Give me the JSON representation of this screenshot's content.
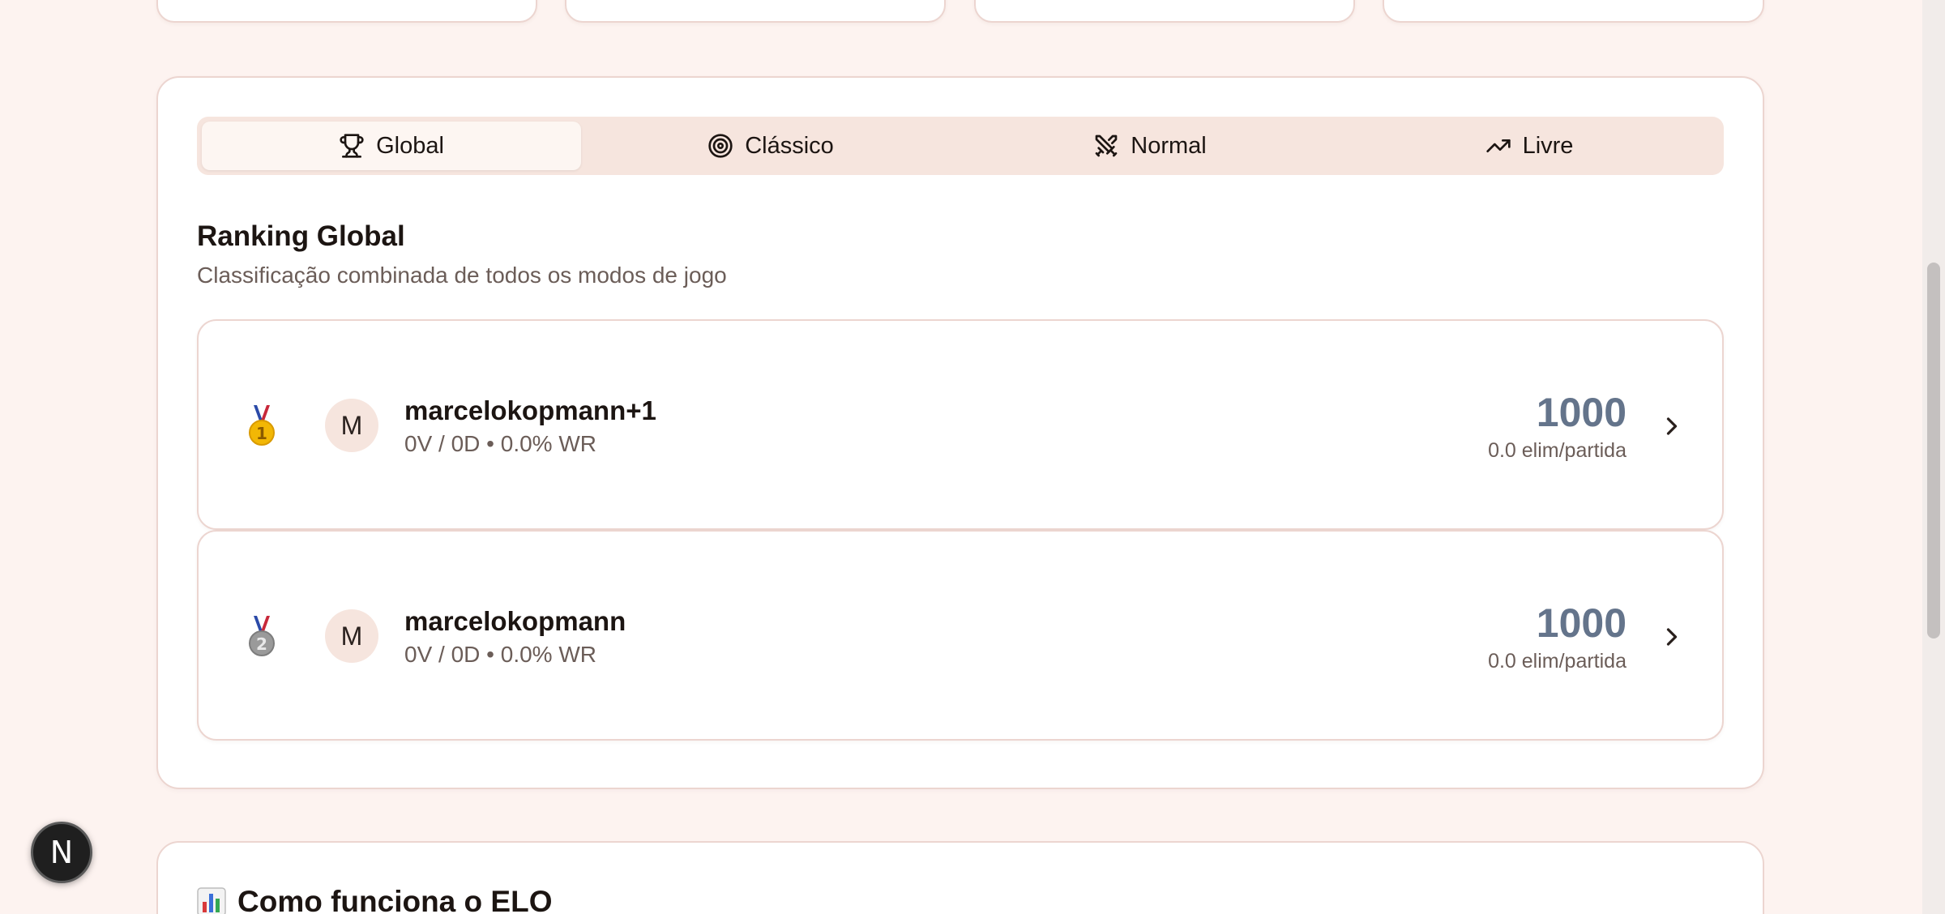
{
  "tabs": [
    {
      "label": "Global",
      "icon": "trophy-icon",
      "active": true
    },
    {
      "label": "Clássico",
      "icon": "target-icon",
      "active": false
    },
    {
      "label": "Normal",
      "icon": "swords-icon",
      "active": false
    },
    {
      "label": "Livre",
      "icon": "trending-up-icon",
      "active": false
    }
  ],
  "ranking": {
    "title": "Ranking Global",
    "description": "Classificação combinada de todos os modos de jogo",
    "players": [
      {
        "rank": "1",
        "medal": "gold-medal-icon",
        "initial": "M",
        "name": "marcelokopmann+1",
        "stats": "0V / 0D • 0.0% WR",
        "score": "1000",
        "elim": "0.0 elim/partida"
      },
      {
        "rank": "2",
        "medal": "silver-medal-icon",
        "initial": "M",
        "name": "marcelokopmann",
        "stats": "0V / 0D • 0.0% WR",
        "score": "1000",
        "elim": "0.0 elim/partida"
      }
    ]
  },
  "elo": {
    "title": "Como funciona o ELO",
    "icon": "bar-chart-icon"
  },
  "dev_button": {
    "label": "N"
  },
  "colors": {
    "background": "#fdf3f0",
    "tab_bar": "#f6e5de",
    "border": "#ecd5d0",
    "score": "#64748b"
  }
}
